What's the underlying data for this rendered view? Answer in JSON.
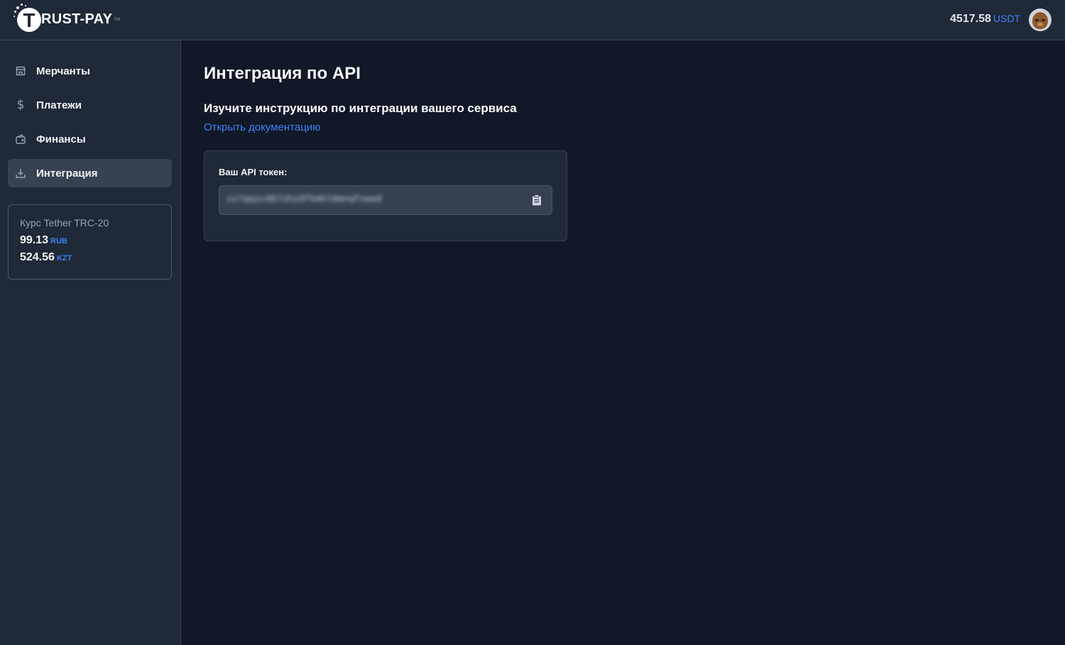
{
  "header": {
    "logo_text": "RUST-PAY",
    "logo_tm": "TM",
    "balance_amount": "4517.58",
    "balance_currency": "USDT",
    "avatar_icon": "bear-avatar-icon"
  },
  "sidebar": {
    "items": [
      {
        "label": "Мерчанты",
        "icon": "store-icon"
      },
      {
        "label": "Платежи",
        "icon": "dollar-icon"
      },
      {
        "label": "Финансы",
        "icon": "wallet-icon"
      },
      {
        "label": "Интеграция",
        "icon": "download-icon",
        "active": true
      }
    ],
    "rate_card": {
      "title": "Курс Tether TRC-20",
      "rates": [
        {
          "value": "99.13",
          "currency": "RUB"
        },
        {
          "value": "524.56",
          "currency": "KZT"
        }
      ]
    }
  },
  "main": {
    "title": "Интеграция по API",
    "subtitle": "Изучите инструкцию по интеграции вашего сервиса",
    "doc_link": "Открыть документацию",
    "token": {
      "label": "Ваш API токен:",
      "value": "xx7qqzcd87shzdfkmhl8mnqfxwad",
      "copy_icon": "clipboard-icon"
    }
  },
  "colors": {
    "page_bg": "#111827",
    "panel_bg": "#1f2937",
    "accent": "#3b82f6"
  }
}
